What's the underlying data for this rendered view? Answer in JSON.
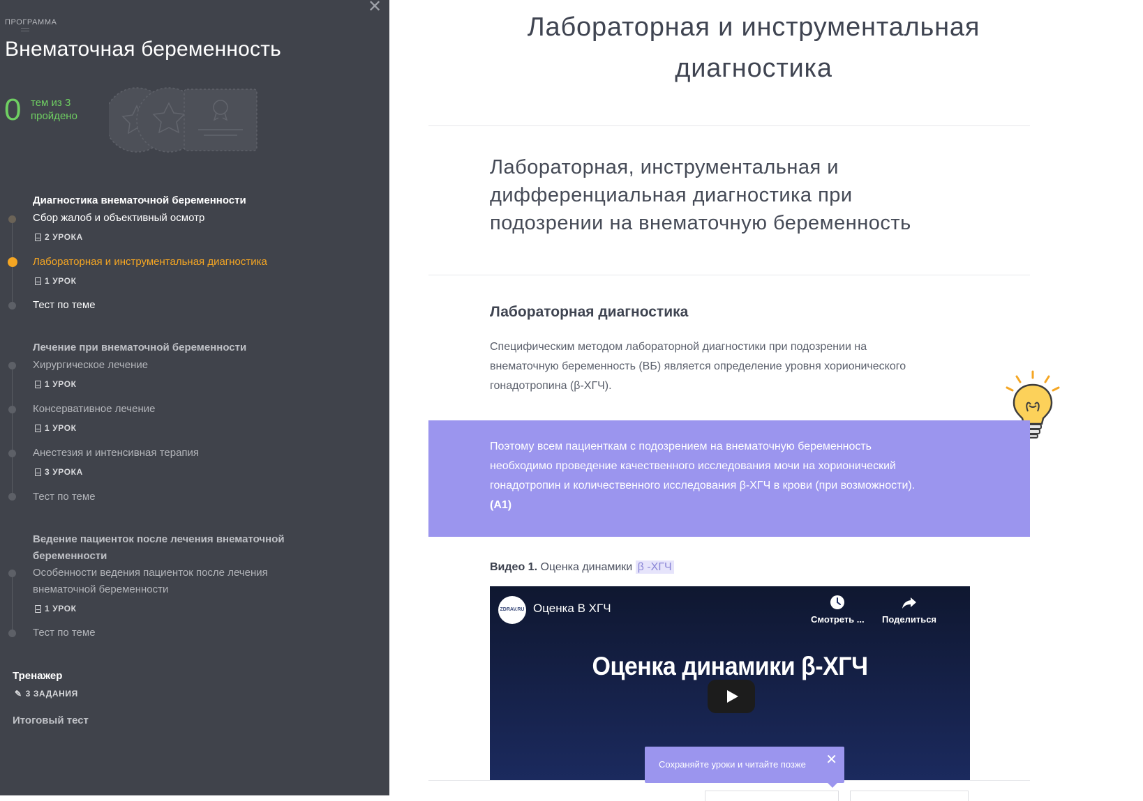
{
  "sidebar": {
    "program_label": "ПРОГРАММА",
    "course_title": "Внематочная беременность",
    "progress": {
      "done": "0",
      "text_line1": "тем из 3",
      "text_line2": "пройдено"
    },
    "sections": [
      {
        "title": "Диагностика внематочной беременности",
        "items": [
          {
            "label": "Сбор жалоб и объективный осмотр",
            "count": "2 УРОКА"
          },
          {
            "label": "Лабораторная и инструментальная диагностика",
            "count": "1 УРОК",
            "active": true
          },
          {
            "label": "Тест по теме"
          }
        ]
      },
      {
        "title": "Лечение при внематочной беременности",
        "items": [
          {
            "label": "Хирургическое лечение",
            "count": "1 УРОК"
          },
          {
            "label": "Консервативное лечение",
            "count": "1 УРОК"
          },
          {
            "label": "Анестезия и интенсивная терапия",
            "count": "3 УРОКА"
          },
          {
            "label": "Тест по теме"
          }
        ]
      },
      {
        "title_line1": "Ведение пациенток после лечения внематочной",
        "title_line2": "беременности",
        "items": [
          {
            "label_line1": "Особенности ведения пациенток после лечения",
            "label_line2": "внематочной беременности",
            "count": "1 УРОК"
          },
          {
            "label": "Тест по теме"
          }
        ]
      }
    ],
    "trainer": {
      "title": "Тренажер",
      "count": "3 ЗАДАНИЯ"
    },
    "final_test": "Итоговый тест"
  },
  "main": {
    "title_line1": "Лабораторная и инструментальная",
    "title_line2": "диагностика",
    "subtitle_line1": "Лабораторная, инструментальная и",
    "subtitle_line2": "дифференциальная диагностика при",
    "subtitle_line3": "подозрении на внематочную беременность",
    "section_heading": "Лабораторная диагностика",
    "paragraph_line1": "Специфическим методом лабораторной диагностики при подозрении на",
    "paragraph_line2": "внематочную беременность (ВБ) является определение уровня хорионического",
    "paragraph_line3": "гонадотропина (β-ХГЧ).",
    "callout_line1": "Поэтому всем пациенткам с подозрением на внематочную беременность",
    "callout_line2": "необходимо проведение качественного исследования мочи на хорионический",
    "callout_line3": "гонадотропин и количественного исследования β-ХГЧ в крови (при возможности).",
    "callout_grade": "(A1)",
    "video_caption": {
      "prefix": "Видео 1.",
      "text": "Оценка динамики",
      "highlight": "β -ХГЧ"
    },
    "player": {
      "logo_text": "ZDRAV.RU",
      "title": "Оценка В ХГЧ",
      "watch_later": "Смотреть ...",
      "share": "Поделиться",
      "big_text": "Оценка динамики β-ХГЧ"
    },
    "toast": {
      "text": "Сохраняйте уроки и читайте позже",
      "close": "✕"
    }
  },
  "colors": {
    "sidebar_bg": "#40434b",
    "progress_green": "#6fcf62",
    "active_orange": "#f5a623",
    "callout_purple": "#9b95ee"
  }
}
